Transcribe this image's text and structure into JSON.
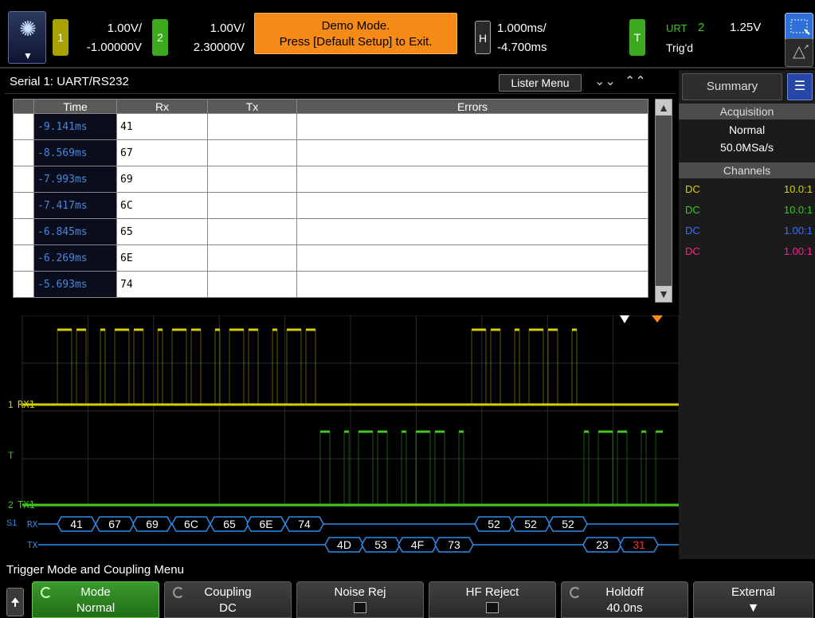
{
  "top_bar": {
    "ch1": {
      "number": "1",
      "scale": "1.00V/",
      "offset": "-1.00000V",
      "color": "#d6cf00"
    },
    "ch2": {
      "number": "2",
      "scale": "1.00V/",
      "offset": "2.30000V",
      "color": "#3cc81c"
    },
    "demo_message_line1": "Demo Mode.",
    "demo_message_line2": "Press [Default Setup] to Exit.",
    "horizontal": {
      "label": "H",
      "time_scale": "1.000ms/",
      "delay": "-4.700ms"
    },
    "trigger": {
      "label": "T",
      "type": "URT",
      "source": "2",
      "level": "1.25V",
      "status": "Trig'd"
    }
  },
  "lister": {
    "title": "Serial 1: UART/RS232",
    "menu_button": "Lister Menu",
    "columns": [
      "Time",
      "Rx",
      "Tx",
      "Errors"
    ],
    "rows": [
      {
        "time": "-9.141ms",
        "rx": "41",
        "tx": "",
        "errors": ""
      },
      {
        "time": "-8.569ms",
        "rx": "67",
        "tx": "",
        "errors": ""
      },
      {
        "time": "-7.993ms",
        "rx": "69",
        "tx": "",
        "errors": ""
      },
      {
        "time": "-7.417ms",
        "rx": "6C",
        "tx": "",
        "errors": ""
      },
      {
        "time": "-6.845ms",
        "rx": "65",
        "tx": "",
        "errors": ""
      },
      {
        "time": "-6.269ms",
        "rx": "6E",
        "tx": "",
        "errors": ""
      },
      {
        "time": "-5.693ms",
        "rx": "74",
        "tx": "",
        "errors": ""
      }
    ]
  },
  "scope": {
    "ch1_marker": "1",
    "ch2_marker": "2",
    "trigger_marker": "T",
    "ch1_label": "RX1",
    "ch2_label": "TX1",
    "serial_marker": "S1",
    "rx_label": "RX",
    "tx_label": "TX",
    "rx_bytes": [
      "41",
      "67",
      "69",
      "6C",
      "65",
      "6E",
      "74",
      "52",
      "52",
      "52"
    ],
    "tx_bytes": [
      "4D",
      "53",
      "4F",
      "73",
      "23",
      "31"
    ],
    "tx_error_byte": "31",
    "decode_color": "#2f8be6",
    "error_color": "#ff2a2a"
  },
  "summary": {
    "tab": "Summary",
    "acq_header": "Acquisition",
    "acq_mode": "Normal",
    "sample_rate": "50.0MSa/s",
    "channels_header": "Channels",
    "channels": [
      {
        "coupling": "DC",
        "probe": "10.0:1",
        "color": "#d6cf00"
      },
      {
        "coupling": "DC",
        "probe": "10.0:1",
        "color": "#3cc81c"
      },
      {
        "coupling": "DC",
        "probe": "1.00:1",
        "color": "#3b6cff"
      },
      {
        "coupling": "DC",
        "probe": "1.00:1",
        "color": "#ff1f8a"
      }
    ]
  },
  "menu": {
    "title": "Trigger Mode and Coupling Menu",
    "softkeys": [
      {
        "label": "Mode",
        "value": "Normal"
      },
      {
        "label": "Coupling",
        "value": "DC"
      },
      {
        "label": "Noise Rej",
        "value": ""
      },
      {
        "label": "HF Reject",
        "value": ""
      },
      {
        "label": "Holdoff",
        "value": "40.0ns"
      },
      {
        "label": "External",
        "value": ""
      }
    ]
  }
}
